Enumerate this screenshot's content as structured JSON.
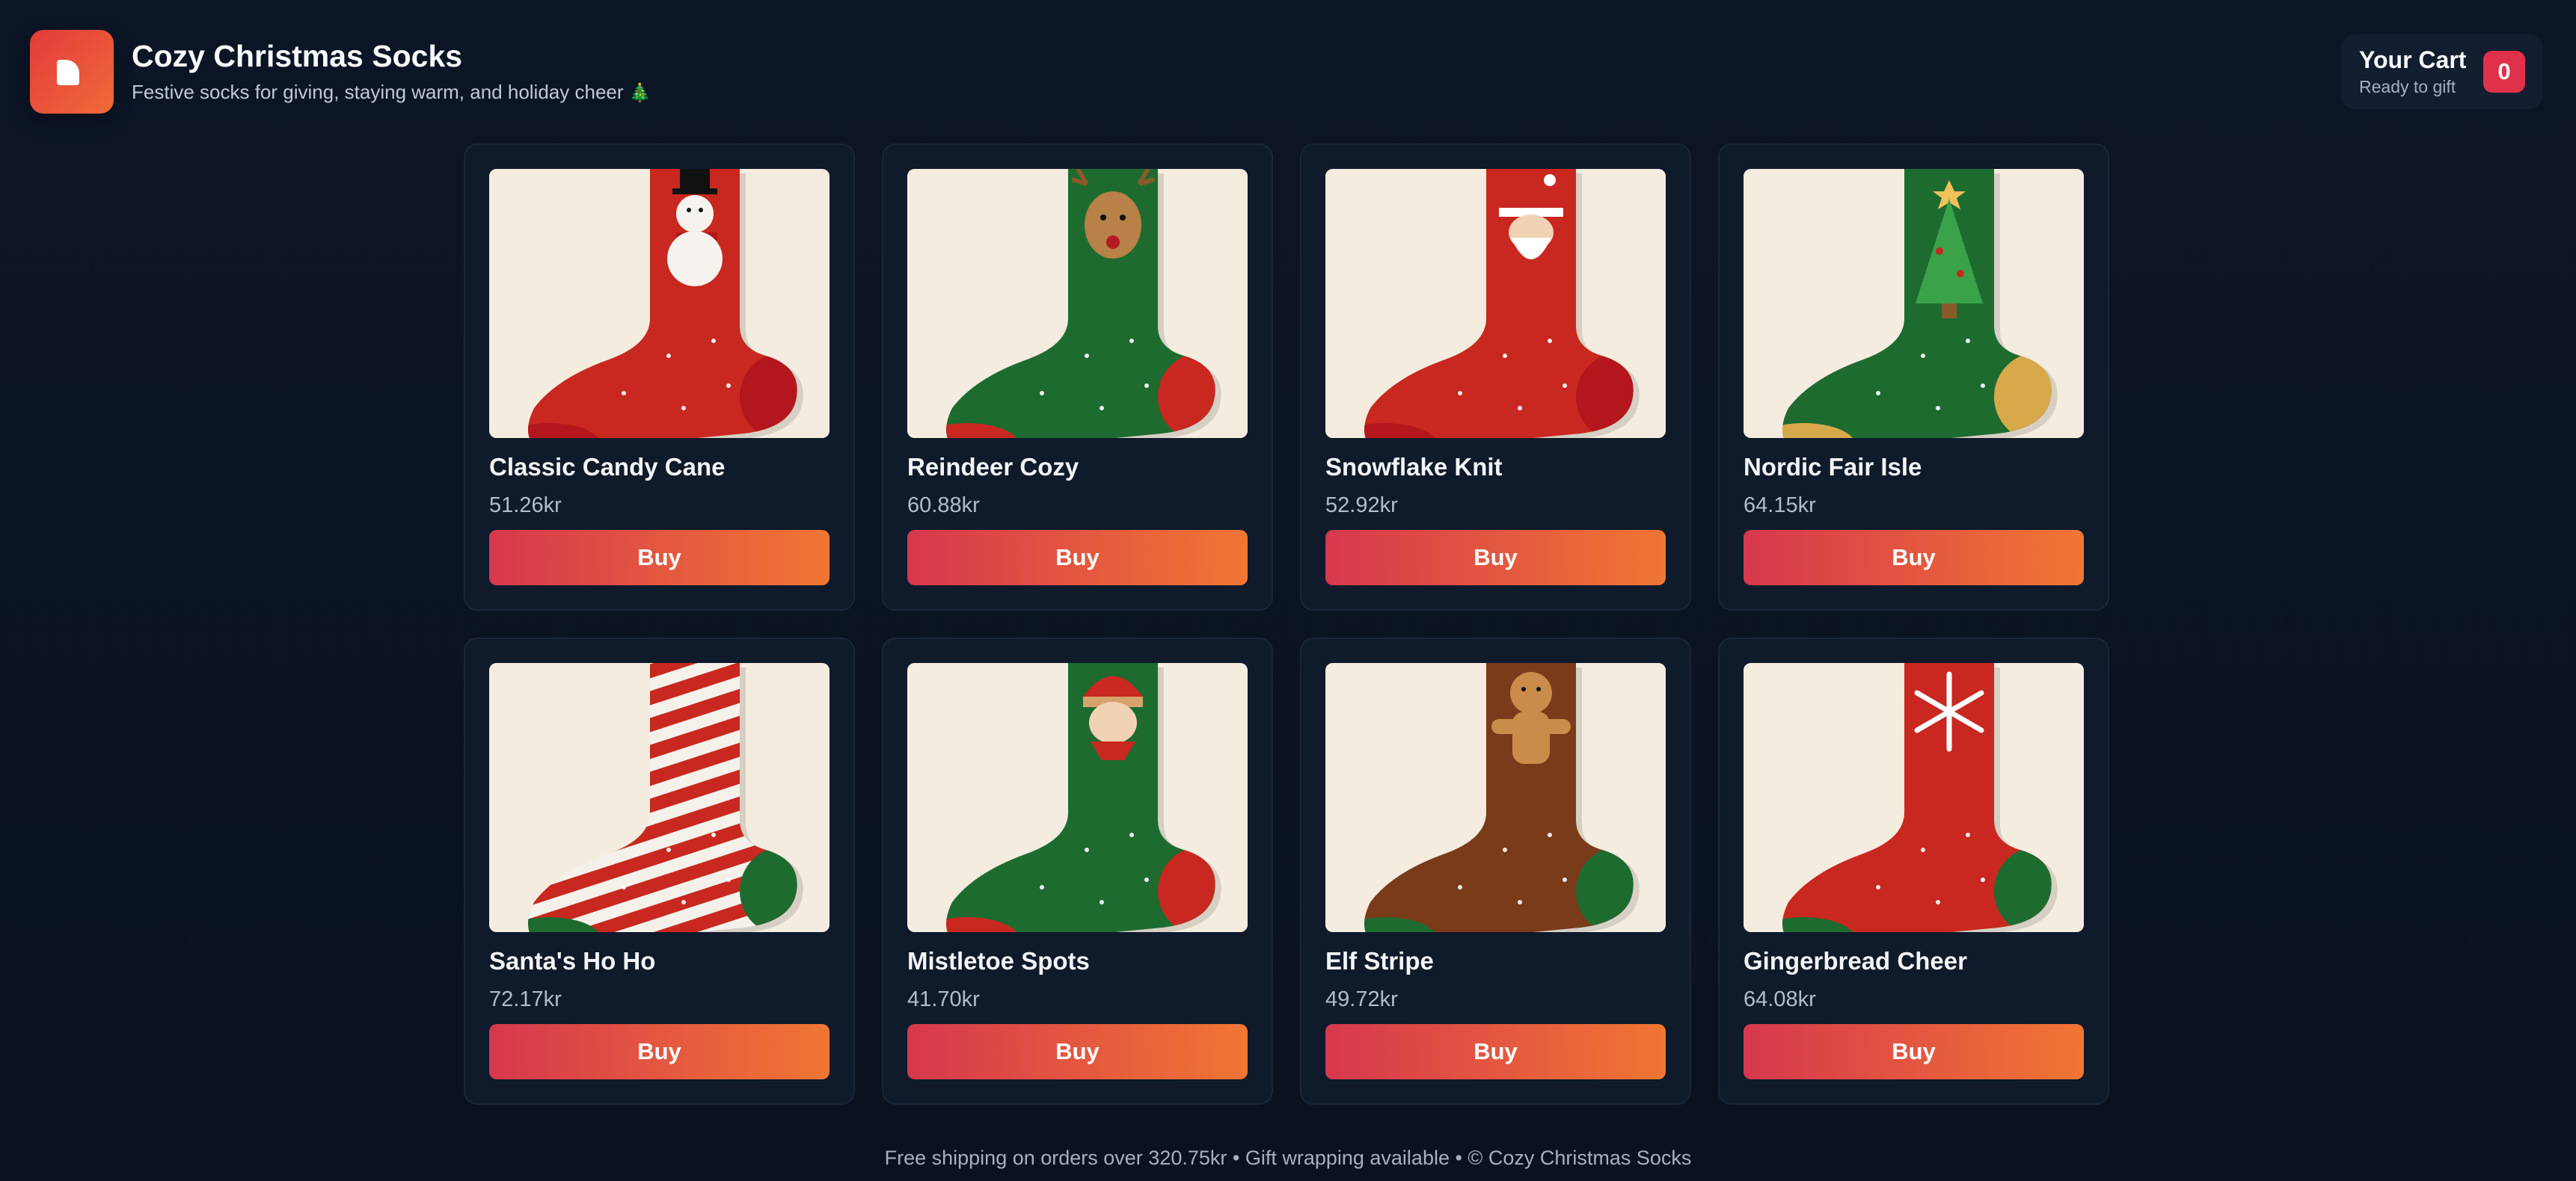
{
  "header": {
    "title": "Cozy Christmas Socks",
    "subtitle": "Festive socks for giving, staying warm, and holiday cheer",
    "subtitle_emoji": "🎄"
  },
  "cart": {
    "title": "Your Cart",
    "subtitle": "Ready to gift",
    "count": "0"
  },
  "products": [
    {
      "name": "Classic Candy Cane",
      "price": "51.26kr",
      "buy": "Buy",
      "sock_color": "#c8281f",
      "motif": "snowman"
    },
    {
      "name": "Reindeer Cozy",
      "price": "60.88kr",
      "buy": "Buy",
      "sock_color": "#1e6b30",
      "motif": "reindeer"
    },
    {
      "name": "Snowflake Knit",
      "price": "52.92kr",
      "buy": "Buy",
      "sock_color": "#c8281f",
      "motif": "santa"
    },
    {
      "name": "Nordic Fair Isle",
      "price": "64.15kr",
      "buy": "Buy",
      "sock_color": "#1e6b30",
      "motif": "tree"
    },
    {
      "name": "Santa's Ho Ho",
      "price": "72.17kr",
      "buy": "Buy",
      "sock_color": "#f4f1ea",
      "motif": "stripes"
    },
    {
      "name": "Mistletoe Spots",
      "price": "41.70kr",
      "buy": "Buy",
      "sock_color": "#1e6b30",
      "motif": "elf"
    },
    {
      "name": "Elf Stripe",
      "price": "49.72kr",
      "buy": "Buy",
      "sock_color": "#7a3b1b",
      "motif": "gingerbread"
    },
    {
      "name": "Gingerbread Cheer",
      "price": "64.08kr",
      "buy": "Buy",
      "sock_color": "#c8281f",
      "motif": "snowflake"
    }
  ],
  "footer": {
    "text": "Free shipping on orders over 320.75kr • Gift wrapping available • © Cozy Christmas Socks"
  },
  "colors": {
    "accent_start": "#d6384d",
    "accent_end": "#f07633",
    "badge": "#e0314b",
    "background": "#0c1526"
  }
}
